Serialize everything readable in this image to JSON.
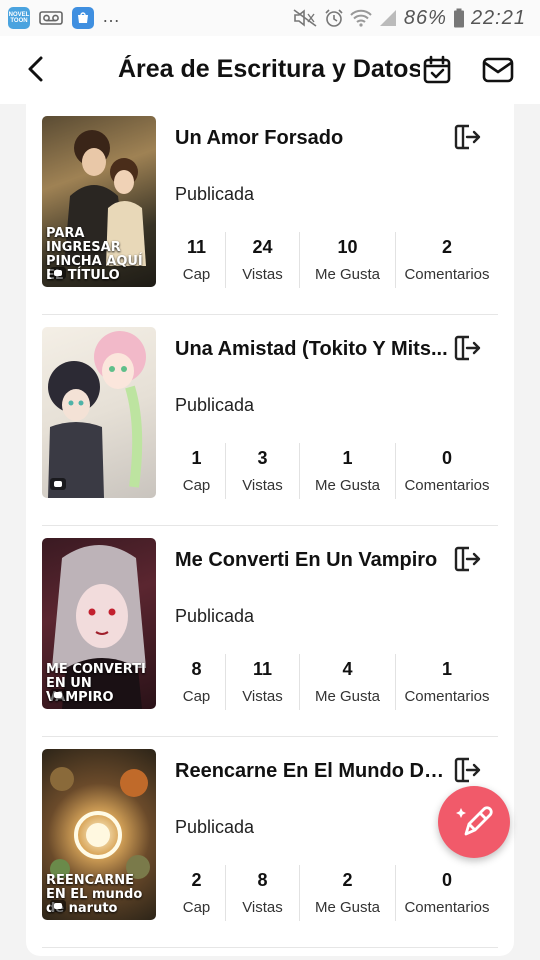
{
  "status_bar": {
    "app1_label": "NOVEL TOON",
    "battery_percent": "86%",
    "time": "22:21"
  },
  "header": {
    "title": "Área de Escritura y Datos"
  },
  "books": [
    {
      "title": "Un Amor Forsado",
      "status": "Publicada",
      "cover_text": "PARA INGRESAR PINCHA AQUÍ EL TÍTULO",
      "stats": [
        {
          "value": "11",
          "label": "Cap"
        },
        {
          "value": "24",
          "label": "Vistas"
        },
        {
          "value": "10",
          "label": "Me Gusta"
        },
        {
          "value": "2",
          "label": "Comentarios"
        }
      ]
    },
    {
      "title": "Una Amistad (Tokito Y Mits...",
      "status": "Publicada",
      "cover_text": "",
      "stats": [
        {
          "value": "1",
          "label": "Cap"
        },
        {
          "value": "3",
          "label": "Vistas"
        },
        {
          "value": "1",
          "label": "Me Gusta"
        },
        {
          "value": "0",
          "label": "Comentarios"
        }
      ]
    },
    {
      "title": "Me Converti En Un Vampiro",
      "status": "Publicada",
      "cover_text": "ME CONVERTI EN UN VAMPIRO",
      "stats": [
        {
          "value": "8",
          "label": "Cap"
        },
        {
          "value": "11",
          "label": "Vistas"
        },
        {
          "value": "4",
          "label": "Me Gusta"
        },
        {
          "value": "1",
          "label": "Comentarios"
        }
      ]
    },
    {
      "title": "Reencarne En El Mundo De ...",
      "status": "Publicada",
      "cover_text": "REENCARNE EN EL mundo de naruto",
      "stats": [
        {
          "value": "2",
          "label": "Cap"
        },
        {
          "value": "8",
          "label": "Vistas"
        },
        {
          "value": "2",
          "label": "Me Gusta"
        },
        {
          "value": "0",
          "label": "Comentarios"
        }
      ]
    }
  ],
  "colors": {
    "accent_fab": "#f15a6a",
    "background": "#f3f3f3",
    "panel": "#ffffff"
  },
  "icons": {
    "back": "chevron-left-icon",
    "calendar": "calendar-check-icon",
    "mail": "mail-icon",
    "exit": "exit-door-icon",
    "fab": "pencil-sparkle-icon"
  }
}
